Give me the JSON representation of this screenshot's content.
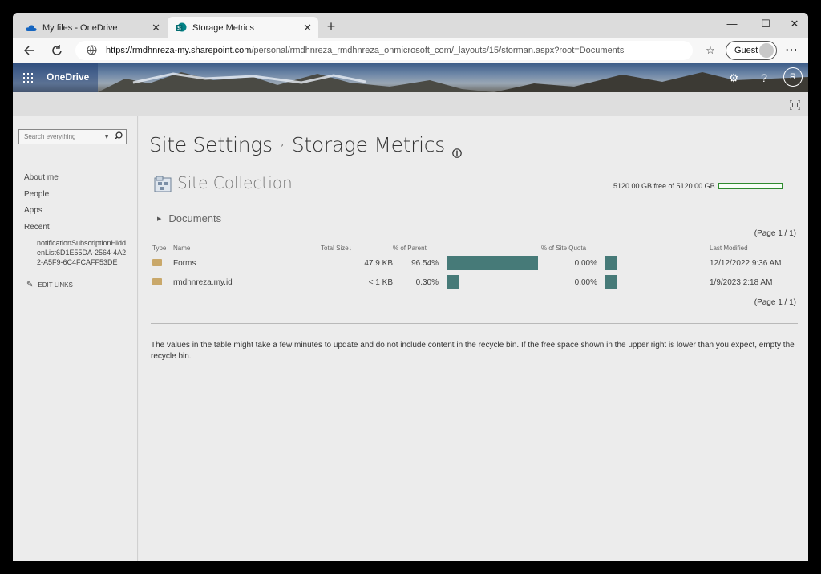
{
  "browser": {
    "tabs": [
      {
        "title": "My files - OneDrive",
        "active": false
      },
      {
        "title": "Storage Metrics",
        "active": true
      }
    ],
    "url_host": "https://rmdhnreza-my.sharepoint.com",
    "url_path": "/personal/rmdhnreza_rmdhnreza_onmicrosoft_com/_layouts/15/storman.aspx?root=Documents",
    "profile_label": "Guest",
    "window_controls": {
      "minimize": "—",
      "maximize": "☐",
      "close": "✕"
    }
  },
  "suitebar": {
    "app_name": "OneDrive",
    "user_initial": "R"
  },
  "leftnav": {
    "search_placeholder": "Search everything",
    "links": [
      "About me",
      "People",
      "Apps",
      "Recent"
    ],
    "recent_item": "notificationSubscriptionHiddenList6D1E55DA-2564-4A22-A5F9-6C4FCAFF53DE",
    "edit_links": "EDIT LINKS"
  },
  "main": {
    "title_part1": "Site Settings",
    "title_sep": "›",
    "title_part2": "Storage Metrics",
    "section_title": "Site Collection",
    "quota_text": "5120.00 GB free of 5120.00 GB",
    "breadcrumb": "Documents",
    "pager": "(Page 1 / 1)",
    "columns": {
      "type": "Type",
      "name": "Name",
      "total_size": "Total Size",
      "pct_parent": "% of Parent",
      "pct_quota": "% of Site Quota",
      "last_modified": "Last Modified"
    },
    "rows": [
      {
        "name": "Forms",
        "size": "47.9 KB",
        "pct_parent": "96.54%",
        "pct_parent_value": 96.54,
        "pct_quota": "0.00%",
        "modified": "12/12/2022 9:36 AM"
      },
      {
        "name": "rmdhnreza.my.id",
        "size": "< 1 KB",
        "pct_parent": "0.30%",
        "pct_parent_value": 0.3,
        "pct_quota": "0.00%",
        "modified": "1/9/2023 2:18 AM"
      }
    ],
    "note": "The values in the table might take a few minutes to update and do not include content in the recycle bin. If the free space shown in the upper right is lower than you expect, empty the recycle bin."
  },
  "colors": {
    "bar": "#467a78",
    "quota_border": "#2e8b2e"
  }
}
